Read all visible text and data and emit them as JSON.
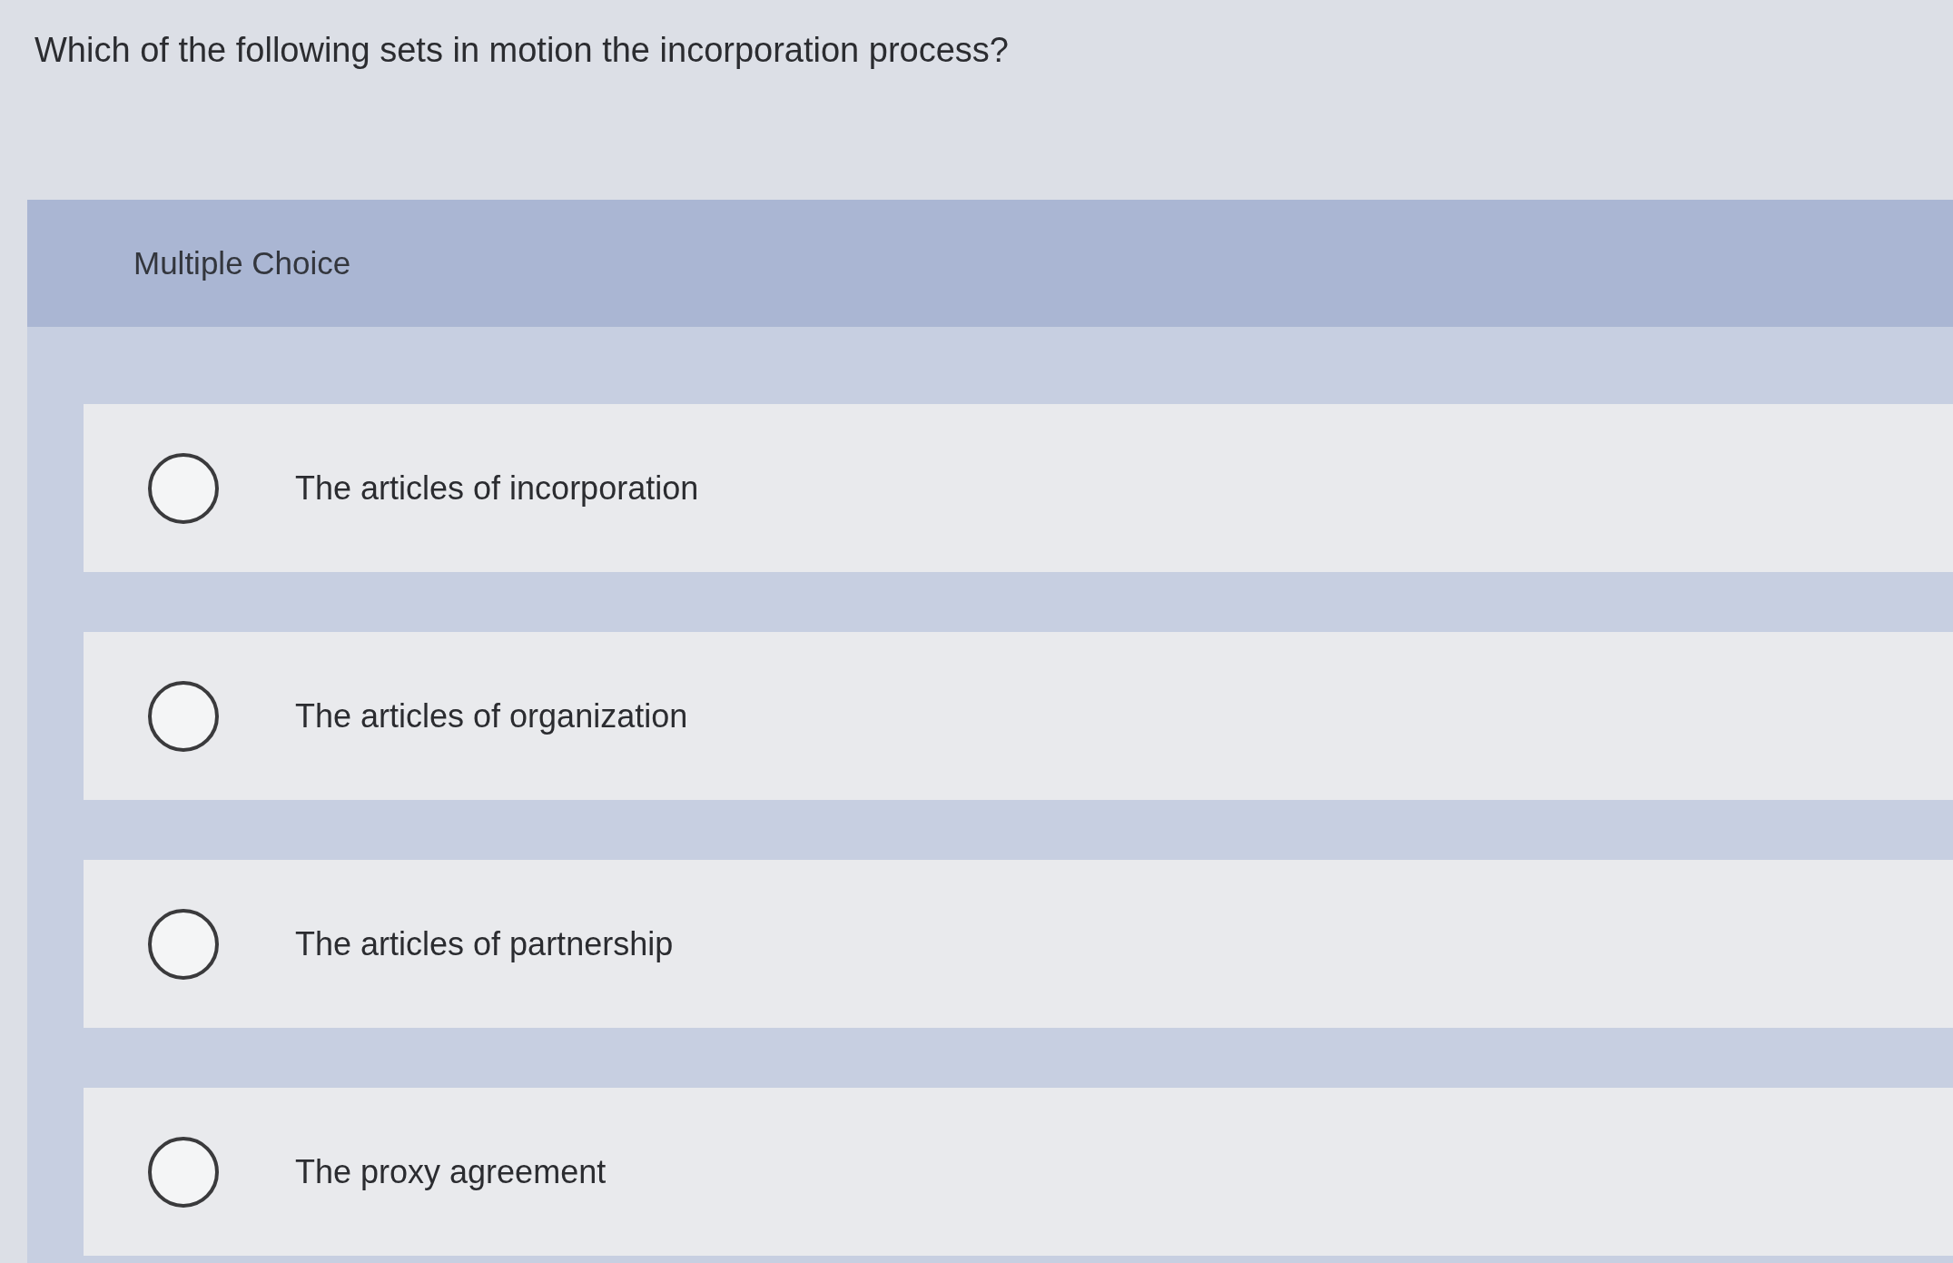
{
  "question": "Which of the following sets in motion the incorporation process?",
  "panel": {
    "header": "Multiple Choice"
  },
  "options": [
    {
      "label": "The articles of incorporation",
      "selected": false
    },
    {
      "label": "The articles of organization",
      "selected": false
    },
    {
      "label": "The articles of partnership",
      "selected": false
    },
    {
      "label": "The proxy agreement",
      "selected": false
    }
  ]
}
